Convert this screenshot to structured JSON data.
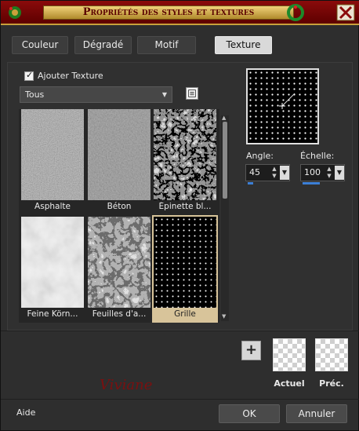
{
  "window": {
    "title": "Propriétés des styles et textures"
  },
  "tabs": [
    {
      "label": "Couleur"
    },
    {
      "label": "Dégradé"
    },
    {
      "label": "Motif"
    },
    {
      "label": "Texture",
      "active": true
    }
  ],
  "texture": {
    "add_texture_label": "Ajouter Texture",
    "add_texture_checked": true,
    "category": "Tous",
    "items": [
      {
        "name": "Asphalte",
        "style": "asphalt"
      },
      {
        "name": "Béton",
        "style": "concrete"
      },
      {
        "name": "Épinette bl...",
        "style": "spruce"
      },
      {
        "name": "Feine Körn...",
        "style": "fine-grain"
      },
      {
        "name": "Feuilles d'a...",
        "style": "leaves"
      },
      {
        "name": "Grille",
        "style": "grid",
        "selected": true
      }
    ]
  },
  "angle": {
    "label": "Angle:",
    "value": "45",
    "level": 0.125
  },
  "scale": {
    "label": "Échelle:",
    "value": "100",
    "level": 0.55
  },
  "swatches": {
    "current_label": "Actuel",
    "previous_label": "Préc."
  },
  "watermark": "Viviane",
  "footer": {
    "help": "Aide",
    "ok": "OK",
    "cancel": "Annuler"
  },
  "colors": {
    "titlebar": "#7a0505",
    "title_gold": "#d9b45a",
    "accent": "#3c7fd6",
    "selection": "#d8c49a"
  },
  "icons": [
    "checkbox-check-icon",
    "chevron-down-icon",
    "texture-library-icon",
    "scroll-up-icon",
    "scroll-down-icon",
    "plus-icon",
    "spin-up-icon",
    "spin-down-icon"
  ]
}
